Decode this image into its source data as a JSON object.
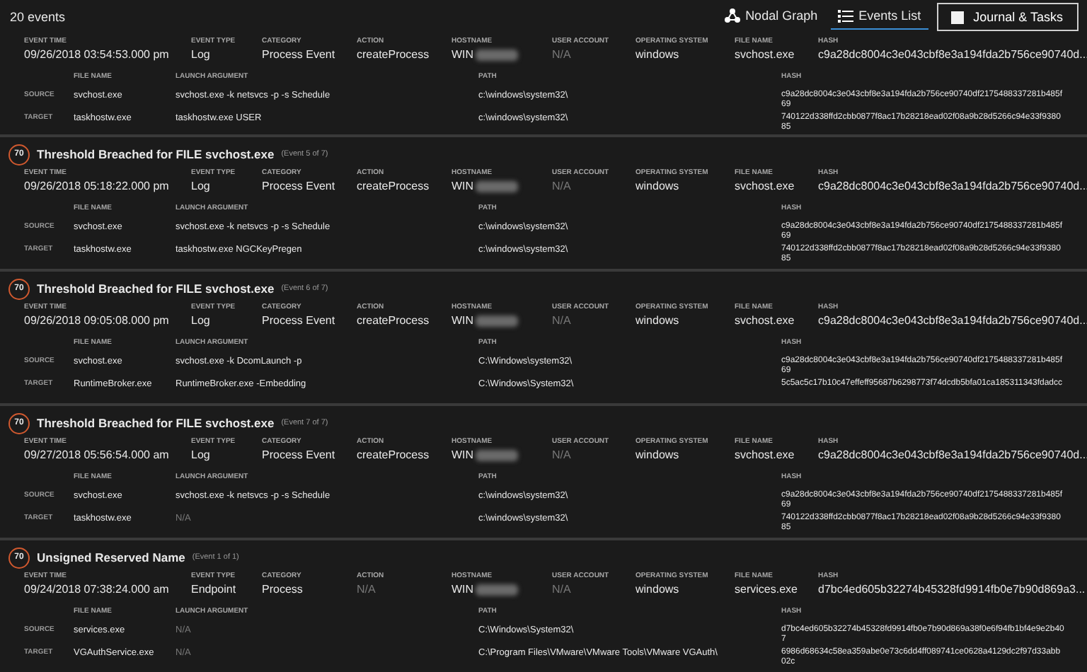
{
  "toolbar": {
    "count": "20 events",
    "views": [
      {
        "label": "Nodal Graph",
        "kind": "graph",
        "selected": false
      },
      {
        "label": "Events List",
        "kind": "list",
        "selected": true
      }
    ],
    "journal_button": "Journal & Tasks"
  },
  "events": [
    {
      "fields": [
        {
          "label": "EVENT TIME",
          "value": "09/26/2018 03:54:53.000 pm",
          "muted": false,
          "redacted": false
        },
        {
          "label": "EVENT TYPE",
          "value": "Log",
          "muted": false,
          "redacted": false
        },
        {
          "label": "CATEGORY",
          "value": "Process Event",
          "muted": false,
          "redacted": false
        },
        {
          "label": "ACTION",
          "value": "createProcess",
          "muted": false,
          "redacted": false
        },
        {
          "label": "HOSTNAME",
          "value": "WIN",
          "muted": false,
          "redacted": true
        },
        {
          "label": "USER ACCOUNT",
          "value": "N/A",
          "muted": true,
          "redacted": false
        },
        {
          "label": "OPERATING SYSTEM",
          "value": "windows",
          "muted": false,
          "redacted": false
        },
        {
          "label": "FILE NAME",
          "value": "svchost.exe",
          "muted": false,
          "redacted": false
        },
        {
          "label": "HASH",
          "value": "c9a28dc8004c3e043cbf8e3a194fda2b756ce90740d...",
          "muted": false,
          "redacted": false
        }
      ],
      "processes": {
        "columns": [
          "FILE NAME",
          "LAUNCH ARGUMENT",
          "PATH",
          "HASH"
        ],
        "rows": [
          {
            "role": "SOURCE",
            "cells": [
              {
                "text": "svchost.exe",
                "muted": false
              },
              {
                "text": "svchost.exe -k netsvcs -p -s Schedule",
                "muted": false
              },
              {
                "text": "c:\\windows\\system32\\",
                "muted": false
              },
              {
                "text": "c9a28dc8004c3e043cbf8e3a194fda2b756ce90740df2175488337281b485f69",
                "muted": false
              }
            ]
          },
          {
            "role": "TARGET",
            "cells": [
              {
                "text": "taskhostw.exe",
                "muted": false
              },
              {
                "text": "taskhostw.exe USER",
                "muted": false
              },
              {
                "text": "c:\\windows\\system32\\",
                "muted": false
              },
              {
                "text": "740122d338ffd2cbb0877f8ac17b28218ead02f08a9b28d5266c94e33f938085",
                "muted": false
              }
            ]
          }
        ]
      }
    },
    {
      "header": {
        "score": "70",
        "title": "Threshold Breached for FILE svchost.exe",
        "counter": "(Event 5 of 7)"
      },
      "fields": [
        {
          "label": "EVENT TIME",
          "value": "09/26/2018 05:18:22.000 pm",
          "muted": false,
          "redacted": false
        },
        {
          "label": "EVENT TYPE",
          "value": "Log",
          "muted": false,
          "redacted": false
        },
        {
          "label": "CATEGORY",
          "value": "Process Event",
          "muted": false,
          "redacted": false
        },
        {
          "label": "ACTION",
          "value": "createProcess",
          "muted": false,
          "redacted": false
        },
        {
          "label": "HOSTNAME",
          "value": "WIN",
          "muted": false,
          "redacted": true
        },
        {
          "label": "USER ACCOUNT",
          "value": "N/A",
          "muted": true,
          "redacted": false
        },
        {
          "label": "OPERATING SYSTEM",
          "value": "windows",
          "muted": false,
          "redacted": false
        },
        {
          "label": "FILE NAME",
          "value": "svchost.exe",
          "muted": false,
          "redacted": false
        },
        {
          "label": "HASH",
          "value": "c9a28dc8004c3e043cbf8e3a194fda2b756ce90740d...",
          "muted": false,
          "redacted": false
        }
      ],
      "processes": {
        "columns": [
          "FILE NAME",
          "LAUNCH ARGUMENT",
          "PATH",
          "HASH"
        ],
        "rows": [
          {
            "role": "SOURCE",
            "cells": [
              {
                "text": "svchost.exe",
                "muted": false
              },
              {
                "text": "svchost.exe -k netsvcs -p -s Schedule",
                "muted": false
              },
              {
                "text": "c:\\windows\\system32\\",
                "muted": false
              },
              {
                "text": "c9a28dc8004c3e043cbf8e3a194fda2b756ce90740df2175488337281b485f69",
                "muted": false
              }
            ]
          },
          {
            "role": "TARGET",
            "cells": [
              {
                "text": "taskhostw.exe",
                "muted": false
              },
              {
                "text": "taskhostw.exe NGCKeyPregen",
                "muted": false
              },
              {
                "text": "c:\\windows\\system32\\",
                "muted": false
              },
              {
                "text": "740122d338ffd2cbb0877f8ac17b28218ead02f08a9b28d5266c94e33f938085",
                "muted": false
              }
            ]
          }
        ]
      }
    },
    {
      "header": {
        "score": "70",
        "title": "Threshold Breached for FILE svchost.exe",
        "counter": "(Event 6 of 7)"
      },
      "fields": [
        {
          "label": "EVENT TIME",
          "value": "09/26/2018 09:05:08.000 pm",
          "muted": false,
          "redacted": false
        },
        {
          "label": "EVENT TYPE",
          "value": "Log",
          "muted": false,
          "redacted": false
        },
        {
          "label": "CATEGORY",
          "value": "Process Event",
          "muted": false,
          "redacted": false
        },
        {
          "label": "ACTION",
          "value": "createProcess",
          "muted": false,
          "redacted": false
        },
        {
          "label": "HOSTNAME",
          "value": "WIN",
          "muted": false,
          "redacted": true
        },
        {
          "label": "USER ACCOUNT",
          "value": "N/A",
          "muted": true,
          "redacted": false
        },
        {
          "label": "OPERATING SYSTEM",
          "value": "windows",
          "muted": false,
          "redacted": false
        },
        {
          "label": "FILE NAME",
          "value": "svchost.exe",
          "muted": false,
          "redacted": false
        },
        {
          "label": "HASH",
          "value": "c9a28dc8004c3e043cbf8e3a194fda2b756ce90740d...",
          "muted": false,
          "redacted": false
        }
      ],
      "processes": {
        "columns": [
          "FILE NAME",
          "LAUNCH ARGUMENT",
          "PATH",
          "HASH"
        ],
        "rows": [
          {
            "role": "SOURCE",
            "cells": [
              {
                "text": "svchost.exe",
                "muted": false
              },
              {
                "text": "svchost.exe -k DcomLaunch -p",
                "muted": false
              },
              {
                "text": "C:\\Windows\\system32\\",
                "muted": false
              },
              {
                "text": "c9a28dc8004c3e043cbf8e3a194fda2b756ce90740df2175488337281b485f69",
                "muted": false
              }
            ]
          },
          {
            "role": "TARGET",
            "cells": [
              {
                "text": "RuntimeBroker.exe",
                "muted": false
              },
              {
                "text": "RuntimeBroker.exe -Embedding",
                "muted": false
              },
              {
                "text": "C:\\Windows\\System32\\",
                "muted": false
              },
              {
                "text": "5c5ac5c17b10c47effeff95687b6298773f74dcdb5bfa01ca185311343fdadcc",
                "muted": false
              }
            ]
          }
        ]
      }
    },
    {
      "header": {
        "score": "70",
        "title": "Threshold Breached for FILE svchost.exe",
        "counter": "(Event 7 of 7)"
      },
      "fields": [
        {
          "label": "EVENT TIME",
          "value": "09/27/2018 05:56:54.000 am",
          "muted": false,
          "redacted": false
        },
        {
          "label": "EVENT TYPE",
          "value": "Log",
          "muted": false,
          "redacted": false
        },
        {
          "label": "CATEGORY",
          "value": "Process Event",
          "muted": false,
          "redacted": false
        },
        {
          "label": "ACTION",
          "value": "createProcess",
          "muted": false,
          "redacted": false
        },
        {
          "label": "HOSTNAME",
          "value": "WIN",
          "muted": false,
          "redacted": true
        },
        {
          "label": "USER ACCOUNT",
          "value": "N/A",
          "muted": true,
          "redacted": false
        },
        {
          "label": "OPERATING SYSTEM",
          "value": "windows",
          "muted": false,
          "redacted": false
        },
        {
          "label": "FILE NAME",
          "value": "svchost.exe",
          "muted": false,
          "redacted": false
        },
        {
          "label": "HASH",
          "value": "c9a28dc8004c3e043cbf8e3a194fda2b756ce90740d...",
          "muted": false,
          "redacted": false
        }
      ],
      "processes": {
        "columns": [
          "FILE NAME",
          "LAUNCH ARGUMENT",
          "PATH",
          "HASH"
        ],
        "rows": [
          {
            "role": "SOURCE",
            "cells": [
              {
                "text": "svchost.exe",
                "muted": false
              },
              {
                "text": "svchost.exe -k netsvcs -p -s Schedule",
                "muted": false
              },
              {
                "text": "c:\\windows\\system32\\",
                "muted": false
              },
              {
                "text": "c9a28dc8004c3e043cbf8e3a194fda2b756ce90740df2175488337281b485f69",
                "muted": false
              }
            ]
          },
          {
            "role": "TARGET",
            "cells": [
              {
                "text": "taskhostw.exe",
                "muted": false
              },
              {
                "text": "N/A",
                "muted": true
              },
              {
                "text": "c:\\windows\\system32\\",
                "muted": false
              },
              {
                "text": "740122d338ffd2cbb0877f8ac17b28218ead02f08a9b28d5266c94e33f938085",
                "muted": false
              }
            ]
          }
        ]
      }
    },
    {
      "header": {
        "score": "70",
        "title": "Unsigned Reserved Name",
        "counter": "(Event 1 of 1)"
      },
      "fields": [
        {
          "label": "EVENT TIME",
          "value": "09/24/2018 07:38:24.000 am",
          "muted": false,
          "redacted": false
        },
        {
          "label": "EVENT TYPE",
          "value": "Endpoint",
          "muted": false,
          "redacted": false
        },
        {
          "label": "CATEGORY",
          "value": "Process",
          "muted": false,
          "redacted": false
        },
        {
          "label": "ACTION",
          "value": "N/A",
          "muted": true,
          "redacted": false
        },
        {
          "label": "HOSTNAME",
          "value": "WIN",
          "muted": false,
          "redacted": true
        },
        {
          "label": "USER ACCOUNT",
          "value": "N/A",
          "muted": true,
          "redacted": false
        },
        {
          "label": "OPERATING SYSTEM",
          "value": "windows",
          "muted": false,
          "redacted": false
        },
        {
          "label": "FILE NAME",
          "value": "services.exe",
          "muted": false,
          "redacted": false
        },
        {
          "label": "HASH",
          "value": "d7bc4ed605b32274b45328fd9914fb0e7b90d869a3...",
          "muted": false,
          "redacted": false
        }
      ],
      "processes": {
        "columns": [
          "FILE NAME",
          "LAUNCH ARGUMENT",
          "PATH",
          "HASH"
        ],
        "rows": [
          {
            "role": "SOURCE",
            "cells": [
              {
                "text": "services.exe",
                "muted": false
              },
              {
                "text": "N/A",
                "muted": true
              },
              {
                "text": "C:\\Windows\\System32\\",
                "muted": false
              },
              {
                "text": "d7bc4ed605b32274b45328fd9914fb0e7b90d869a38f0e6f94fb1bf4e9e2b407",
                "muted": false
              }
            ]
          },
          {
            "role": "TARGET",
            "cells": [
              {
                "text": "VGAuthService.exe",
                "muted": false
              },
              {
                "text": "N/A",
                "muted": true
              },
              {
                "text": "C:\\Program Files\\VMware\\VMware Tools\\VMware VGAuth\\",
                "muted": false
              },
              {
                "text": "6986d68634c58ea359abe0e73c6dd4ff089741ce0628a4129dc2f97d33abb02c",
                "muted": false
              }
            ]
          }
        ]
      }
    }
  ]
}
